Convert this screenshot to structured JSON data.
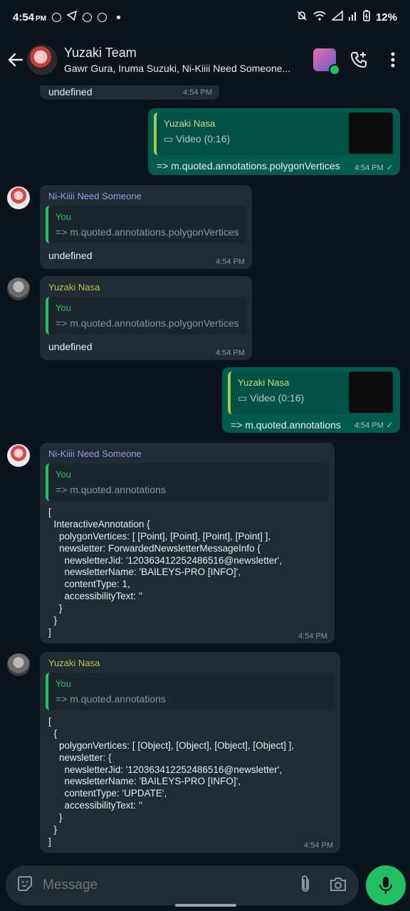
{
  "status_bar": {
    "time": "4:54",
    "ampm": "PM",
    "battery": "12%"
  },
  "header": {
    "title": "Yuzaki Team",
    "subtitle": "Gawr Gura, Iruma Suzuki, Ni-Kiiii Need Someone..."
  },
  "messages": {
    "m0": {
      "text": "undefined",
      "time": "4:54 PM"
    },
    "m1": {
      "quoted_name": "Yuzaki Nasa",
      "quoted_text": "Video (0:16)",
      "text": "=> m.quoted.annotations.polygonVertices",
      "time": "4:54 PM"
    },
    "m2": {
      "sender": "Ni-Kiiii Need Someone",
      "quoted_name": "You",
      "quoted_text": "=> m.quoted.annotations.polygonVertices",
      "text": "undefined",
      "time": "4:54 PM"
    },
    "m3": {
      "sender": "Yuzaki Nasa",
      "quoted_name": "You",
      "quoted_text": "=> m.quoted.annotations.polygonVertices",
      "text": "undefined",
      "time": "4:54 PM"
    },
    "m4": {
      "quoted_name": "Yuzaki Nasa",
      "quoted_text": "Video (0:16)",
      "text": "=> m.quoted.annotations",
      "time": "4:54 PM"
    },
    "m5": {
      "sender": "Ni-Kiiii Need Someone",
      "quoted_name": "You",
      "quoted_text": "=> m.quoted.annotations",
      "text": "[\n  InteractiveAnnotation {\n    polygonVertices: [ [Point], [Point], [Point], [Point] ],\n    newsletter: ForwardedNewsletterMessageInfo {\n      newsletterJid: '120363412252486516@newsletter',\n      newsletterName: 'BAILEYS-PRO [INFO]',\n      contentType: 1,\n      accessibilityText: ''\n    }\n  }\n]",
      "time": "4:54 PM"
    },
    "m6": {
      "sender": "Yuzaki Nasa",
      "quoted_name": "You",
      "quoted_text": "=> m.quoted.annotations",
      "text": "[\n  {\n    polygonVertices: [ [Object], [Object], [Object], [Object] ],\n    newsletter: {\n      newsletterJid: '120363412252486516@newsletter',\n      newsletterName: 'BAILEYS-PRO [INFO]',\n      contentType: 'UPDATE',\n      accessibilityText: ''\n    }\n  }\n]",
      "time": "4:54 PM"
    }
  },
  "input": {
    "placeholder": "Message"
  },
  "colors": {
    "accent": "#21c063",
    "bg": "#0b141a",
    "bubble_in": "#1f2c34",
    "bubble_out": "#005c4b",
    "name_niki": "#a394e8",
    "name_yuzaki": "#c6c24a"
  }
}
